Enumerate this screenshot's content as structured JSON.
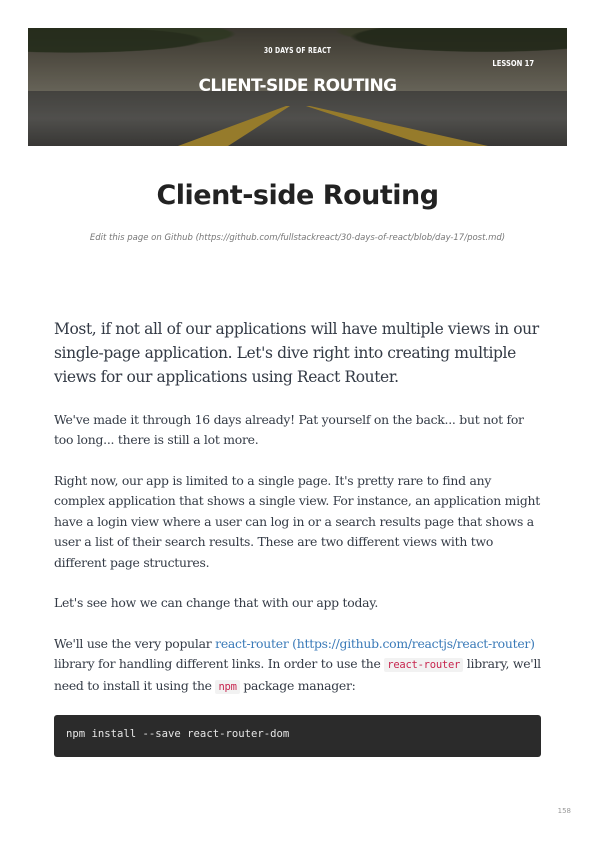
{
  "banner": {
    "series": "30 DAYS OF REACT",
    "title": "CLIENT-SIDE ROUTING",
    "lesson": "LESSON 17"
  },
  "page_title": "Client-side Routing",
  "edit_link": "Edit this page on Github (https://github.com/fullstackreact/30-days-of-react/blob/day-17/post.md)",
  "lead": "Most, if not all of our applications will have multiple views in our single-page application. Let's dive right into creating multiple views for our applications using React Router.",
  "paragraphs": {
    "p1": "We've made it through 16 days already! Pat yourself on the back... but not for too long... there is still a lot more.",
    "p2": "Right now, our app is limited to a single page. It's pretty rare to find any complex application that shows a single view. For instance, an application might have a login view where a user can log in or a search results page that shows a user a list of their search results. These are two different views with two different page structures.",
    "p3": "Let's see how we can change that with our app today.",
    "p4": {
      "before_link": "We'll use the very popular ",
      "link_text": "react-router (https://github.com/reactjs/react-router)",
      "after_link": " library for handling different links. In order to use the ",
      "code1": "react-router",
      "middle": " library, we'll need to install it using the ",
      "code2": "npm",
      "after_code2": " package manager:"
    }
  },
  "code_block": "npm install --save react-router-dom",
  "page_number": "158"
}
